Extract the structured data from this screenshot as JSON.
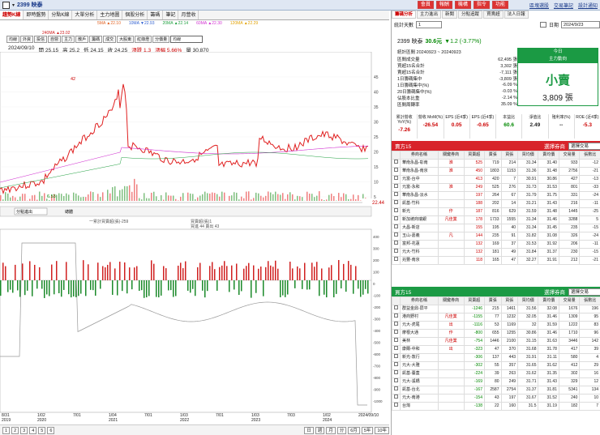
{
  "titlebar": {
    "code": "2399 映泰",
    "tabs": [
      "會員",
      "報酬",
      "機構",
      "指令",
      "功能"
    ],
    "links": [
      "區塊選股",
      "交易筆記",
      "設計通知"
    ]
  },
  "main_tabs": [
    "趨勢K線",
    "即時盤勢",
    "分點K線",
    "大單分析",
    "主力地圖",
    "個股分析",
    "籌碼",
    "筆記",
    "月營收"
  ],
  "ma_legend": [
    {
      "label": "5MA ▲22.10",
      "color": "#e06020"
    },
    {
      "label": "10MA ▼22.93",
      "color": "#3060d0"
    },
    {
      "label": "20MA ▲22.14",
      "color": "#20a040"
    },
    {
      "label": "60MA ▲22.30",
      "color": "#d030d0"
    },
    {
      "label": "120MA ▲22.29",
      "color": "#e0a000"
    },
    {
      "label": "240MA ▲23.02",
      "color": "#d02020"
    }
  ],
  "sub_tabs": [
    "均線",
    "外資",
    "投信",
    "自營",
    "主力",
    "散戶",
    "籌碼",
    "成交",
    "大股東",
    "紅綠燈",
    "分價量"
  ],
  "sub_select": "均線",
  "ohlc": {
    "date": "2024/09/10",
    "open": "開 25.15",
    "high": "高 25.2",
    "low": "低 24.15",
    "close": "收 24.25",
    "change": "漲跌 1.3",
    "pct": "漲幅 5.66%",
    "vol": "量 30,870"
  },
  "price_axis": [
    "45",
    "40",
    "35",
    "30",
    "25",
    "20",
    "15",
    "10",
    "5"
  ],
  "peak_label": "42",
  "low_label": "6.53",
  "last_price": "22.44",
  "indicator": {
    "select": "分點進出",
    "tab": "總體",
    "title": "一累計買賣超(張)-259",
    "legend1": "買賣超(張)1",
    "legend2": "買進 44  賣出 43"
  },
  "ind_axis": [
    "400",
    "300",
    "200",
    "100",
    "0",
    "-100",
    "-200",
    "-300",
    "-400",
    "-500",
    "-600",
    "-700",
    "-800",
    "-900",
    "-1000"
  ],
  "time_axis": [
    {
      "t": "8/31",
      "y": "2019"
    },
    {
      "t": "1/02",
      "y": "2020"
    },
    {
      "t": "7/01",
      "y": ""
    },
    {
      "t": "1/04",
      "y": "2021"
    },
    {
      "t": "7/01",
      "y": ""
    },
    {
      "t": "1/03",
      "y": "2022"
    },
    {
      "t": "7/01",
      "y": ""
    },
    {
      "t": "1/03",
      "y": "2023"
    },
    {
      "t": "7/03",
      "y": ""
    },
    {
      "t": "1/02",
      "y": "2024"
    },
    {
      "t": "2024/09/10",
      "y": ""
    }
  ],
  "bottom": [
    "1",
    "2",
    "3",
    "4",
    "5",
    "6",
    "日",
    "週",
    "月",
    "分",
    "6月",
    "5年",
    "10年"
  ],
  "right": {
    "tabs": [
      "籌碼分析",
      "主力進出",
      "新聞",
      "分點追蹤",
      "買賣超",
      "法人日報"
    ],
    "period_label": "統計天數",
    "period": "1",
    "date_label": "日期",
    "date": "2024/9/23",
    "stock": "2399 映泰",
    "price": "30.6元",
    "chg": "▼1.2 (-3.77%)",
    "range": "統計區間 20240923 ~ 20240923",
    "stats": [
      {
        "l": "區間成交量",
        "v": "62,495 張"
      },
      {
        "l": "買超15名合計",
        "v": "3,302 張"
      },
      {
        "l": "賣超15名合計",
        "v": "-7,111 張"
      },
      {
        "l": "1日籌碼集中",
        "v": "-3,809 張"
      },
      {
        "l": "1日籌碼集中(%)",
        "v": "-6.09 %"
      },
      {
        "l": "20日籌碼集中(%)",
        "v": "-0.03 %"
      },
      {
        "l": "佔股本比重",
        "v": "-2.14 %"
      },
      {
        "l": "區間周轉率",
        "v": "35.09 %"
      }
    ],
    "big": {
      "head1": "今日",
      "head2": "主力動向",
      "word": "小賣",
      "amount": "3,809 張"
    },
    "metrics": [
      {
        "l": "累計營收 YoY(%)",
        "v": "-7.26"
      },
      {
        "l": "營收 MoM(%)",
        "v": "-26.54"
      },
      {
        "l": "EPS (近4季)",
        "v": "0.05"
      },
      {
        "l": "EPS (近4季)",
        "v": "-0.65"
      },
      {
        "l": "本益比",
        "v": "60.6"
      },
      {
        "l": "淨值比",
        "v": "2.49"
      },
      {
        "l": "殖利率(%)",
        "v": "--"
      },
      {
        "l": "ROE (近4季)",
        "v": "-5.3"
      }
    ],
    "buy_title": "賣方15",
    "buy_sel": "選擇券商",
    "buy_sel2": "選擇交易",
    "headers": [
      "券商名稱",
      "關鍵券商",
      "買賣超",
      "賣張",
      "買張",
      "買均價",
      "賣均價",
      "交易量",
      "張數比"
    ],
    "buy_rows": [
      [
        "華南永昌-彰南",
        "淮",
        "525",
        "719",
        "214",
        "31.34",
        "31.40",
        "933",
        "-12"
      ],
      [
        "華南永昌-南京",
        "淮",
        "450",
        "1803",
        "1153",
        "31.36",
        "31.48",
        "2756",
        "-21"
      ],
      [
        "元富-台中",
        "",
        "413",
        "420",
        "7",
        "30.91",
        "30.86",
        "427",
        "-13"
      ],
      [
        "元富-永和",
        "淮",
        "249",
        "525",
        "276",
        "31.73",
        "31.53",
        "801",
        "-33"
      ],
      [
        "華南永昌-淡水",
        "",
        "197",
        "264",
        "67",
        "31.79",
        "31.75",
        "331",
        "-24"
      ],
      [
        "凱基-竹科",
        "",
        "188",
        "202",
        "14",
        "31.21",
        "31.43",
        "216",
        "-11"
      ],
      [
        "新光",
        "作",
        "187",
        "816",
        "629",
        "31.59",
        "31.48",
        "1445",
        "-25"
      ],
      [
        "新加坡商瑞銀",
        "凡佳業",
        "178",
        "1733",
        "1555",
        "31.34",
        "31.46",
        "3288",
        "5"
      ],
      [
        "大昌-新店",
        "",
        "155",
        "195",
        "40",
        "31.34",
        "31.45",
        "235",
        "-15"
      ],
      [
        "玉山-嘉義",
        "凡",
        "144",
        "235",
        "91",
        "31.82",
        "31.08",
        "326",
        "-24"
      ],
      [
        "富邦-花蓮",
        "",
        "132",
        "169",
        "37",
        "31.53",
        "31.92",
        "206",
        "-11"
      ],
      [
        "元大-竹科",
        "",
        "132",
        "181",
        "49",
        "31.84",
        "31.37",
        "230",
        "-15"
      ],
      [
        "兆豐-南京",
        "",
        "118",
        "165",
        "47",
        "32.27",
        "31.91",
        "212",
        "-21"
      ]
    ],
    "sell_title": "買方15",
    "sell_rows": [
      [
        "群益金鼎-屏平",
        "",
        "-1246",
        "215",
        "1461",
        "31.56",
        "32.08",
        "1676",
        "196"
      ],
      [
        "港商野村",
        "凡佳業",
        "-1155",
        "77",
        "1232",
        "32.05",
        "31.46",
        "1309",
        "95"
      ],
      [
        "元大-虎尾",
        "出",
        "-1116",
        "53",
        "1169",
        "32",
        "31.59",
        "1222",
        "83"
      ],
      [
        "摩根大通",
        "作",
        "-800",
        "655",
        "1255",
        "30.86",
        "31.46",
        "1710",
        "96"
      ],
      [
        "美林",
        "凡佳業",
        "-754",
        "1446",
        "2100",
        "31.15",
        "31.63",
        "3446",
        "142"
      ],
      [
        "康爾-中和",
        "出",
        "-323",
        "47",
        "370",
        "31.68",
        "31.78",
        "417",
        "39"
      ],
      [
        "新光-敦行",
        "",
        "-306",
        "137",
        "443",
        "31.91",
        "31.11",
        "580",
        "4"
      ],
      [
        "元大-大雅",
        "",
        "-302",
        "55",
        "357",
        "31.65",
        "31.62",
        "412",
        "29"
      ],
      [
        "凱基-臺蓋",
        "",
        "-224",
        "39",
        "263",
        "31.62",
        "31.35",
        "302",
        "16"
      ],
      [
        "元大-溪橋",
        "",
        "-169",
        "80",
        "249",
        "31.71",
        "31.43",
        "329",
        "12"
      ],
      [
        "凱基-台北",
        "",
        "-167",
        "2587",
        "2754",
        "31.37",
        "31.81",
        "5341",
        "134"
      ],
      [
        "元大-南港",
        "",
        "-154",
        "43",
        "197",
        "31.67",
        "31.52",
        "240",
        "10"
      ],
      [
        "台灣",
        "",
        "-138",
        "22",
        "160",
        "31.5",
        "31.19",
        "182",
        "7"
      ]
    ]
  }
}
